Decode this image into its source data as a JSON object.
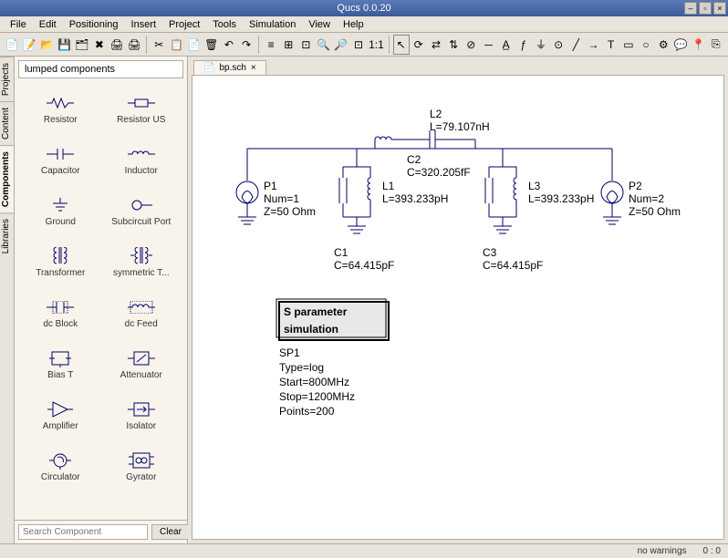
{
  "title": "Qucs 0.0.20",
  "menu": [
    "File",
    "Edit",
    "Positioning",
    "Insert",
    "Project",
    "Tools",
    "Simulation",
    "View",
    "Help"
  ],
  "sidetabs": [
    "Projects",
    "Content",
    "Components",
    "Libraries"
  ],
  "palette": {
    "header": "lumped components",
    "items": [
      {
        "label": "Resistor"
      },
      {
        "label": "Resistor US"
      },
      {
        "label": "Capacitor"
      },
      {
        "label": "Inductor"
      },
      {
        "label": "Ground"
      },
      {
        "label": "Subcircuit Port"
      },
      {
        "label": "Transformer"
      },
      {
        "label": "symmetric T..."
      },
      {
        "label": "dc Block"
      },
      {
        "label": "dc Feed"
      },
      {
        "label": "Bias T"
      },
      {
        "label": "Attenuator"
      },
      {
        "label": "Amplifier"
      },
      {
        "label": "Isolator"
      },
      {
        "label": "Circulator"
      },
      {
        "label": "Gyrator"
      }
    ],
    "search_placeholder": "Search Component",
    "clear": "Clear"
  },
  "docs": {
    "tab1": "bp.sch"
  },
  "circuit": {
    "L2": {
      "name": "L2",
      "val": "L=79.107nH"
    },
    "C2": {
      "name": "C2",
      "val": "C=320.205fF"
    },
    "P1": {
      "name": "P1",
      "l1": "Num=1",
      "l2": "Z=50 Ohm"
    },
    "L1": {
      "name": "L1",
      "val": "L=393.233pH"
    },
    "C1": {
      "name": "C1",
      "val": "C=64.415pF"
    },
    "L3": {
      "name": "L3",
      "val": "L=393.233pH"
    },
    "C3": {
      "name": "C3",
      "val": "C=64.415pF"
    },
    "P2": {
      "name": "P2",
      "l1": "Num=2",
      "l2": "Z=50 Ohm"
    },
    "sim": {
      "title1": "S parameter",
      "title2": "simulation",
      "name": "SP1",
      "l1": "Type=log",
      "l2": "Start=800MHz",
      "l3": "Stop=1200MHz",
      "l4": "Points=200"
    }
  },
  "status": {
    "warn": "no warnings",
    "coord": "0 : 0"
  }
}
